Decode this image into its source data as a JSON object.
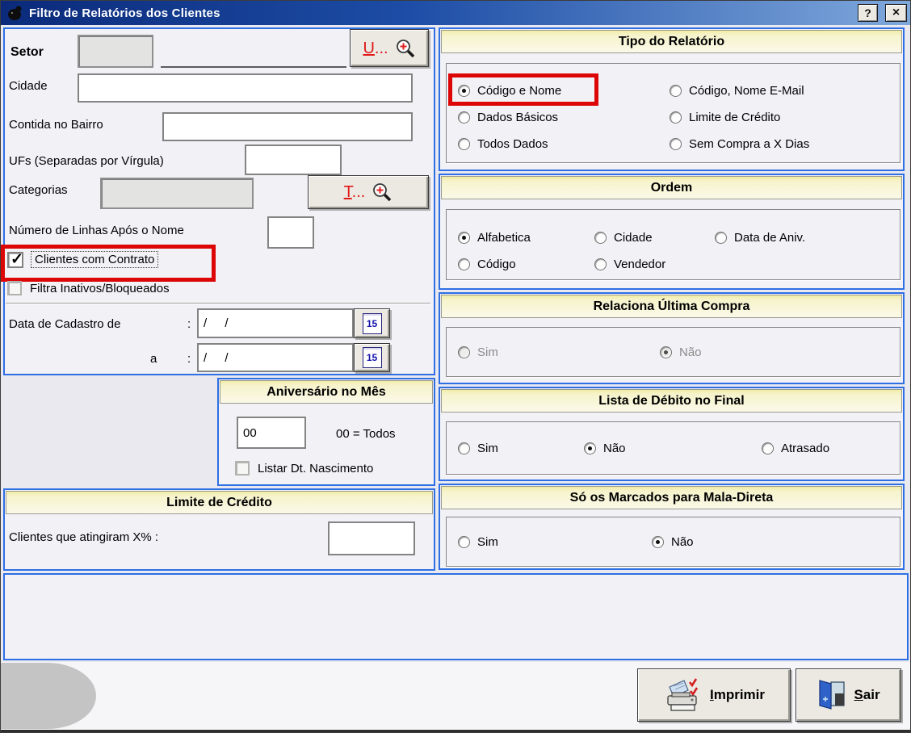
{
  "window": {
    "title": "Filtro de Relatórios dos Clientes",
    "help": "?",
    "close": "×"
  },
  "left": {
    "setor": {
      "label": "Setor",
      "button_key": "U",
      "button_rest": "..."
    },
    "cidade_label": "Cidade",
    "bairro_label": "Contida no Bairro",
    "ufs_label": "UFs (Separadas por Vírgula)",
    "categorias": {
      "label": "Categorias",
      "button_key": "T",
      "button_rest": "..."
    },
    "linhas_label": "Número de Linhas Após o Nome",
    "cb_contrato": {
      "label": "Clientes com Contrato",
      "checked": true,
      "annotated": true
    },
    "cb_inativos": {
      "label": "Filtra Inativos/Bloqueados",
      "checked": false
    },
    "cadastro": {
      "de_label": "Data de Cadastro de",
      "a_label": "a",
      "colon": ":",
      "value": "/ /",
      "cal": "15"
    }
  },
  "aniversario": {
    "title": "Aniversário no Mês",
    "value": "00",
    "hint": "00 = Todos",
    "cb_label": "Listar Dt. Nascimento",
    "cb_checked": false
  },
  "limite": {
    "title": "Limite de Crédito",
    "label": "Clientes que atingiram X% :",
    "value": ""
  },
  "tipo": {
    "title": "Tipo do Relatório",
    "options": [
      {
        "label": "Código e Nome",
        "selected": true,
        "annotated": true
      },
      {
        "label": "Dados Básicos",
        "selected": false
      },
      {
        "label": "Todos Dados",
        "selected": false
      },
      {
        "label": "Código, Nome E-Mail",
        "selected": false
      },
      {
        "label": "Limite de Crédito",
        "selected": false
      },
      {
        "label": "Sem Compra a X Dias",
        "selected": false
      }
    ]
  },
  "ordem": {
    "title": "Ordem",
    "options": [
      {
        "label": "Alfabetica",
        "selected": true
      },
      {
        "label": "Código",
        "selected": false
      },
      {
        "label": "Cidade",
        "selected": false
      },
      {
        "label": "Vendedor",
        "selected": false
      },
      {
        "label": "Data de Aniv.",
        "selected": false
      }
    ]
  },
  "relaciona": {
    "title": "Relaciona Última Compra",
    "disabled": true,
    "options": [
      {
        "label": "Sim",
        "selected": false
      },
      {
        "label": "Não",
        "selected": true
      }
    ]
  },
  "lista_debito": {
    "title": "Lista de Débito no Final",
    "options": [
      {
        "label": "Sim",
        "selected": false
      },
      {
        "label": "Não",
        "selected": true
      },
      {
        "label": "Atrasado",
        "selected": false
      }
    ]
  },
  "mala_direta": {
    "title": "Só os Marcados para Mala-Direta",
    "options": [
      {
        "label": "Sim",
        "selected": false
      },
      {
        "label": "Não",
        "selected": true
      }
    ]
  },
  "actions": {
    "imprimir_key": "I",
    "imprimir_rest": "mprimir",
    "sair_key": "S",
    "sair_rest": "air"
  },
  "colors": {
    "accent_blue": "#2e6fe4",
    "header_yellow": "#fbf9e8",
    "annotation_red": "#dc0606",
    "title_start": "#0b2a7a",
    "title_end": "#7fa8dc"
  }
}
